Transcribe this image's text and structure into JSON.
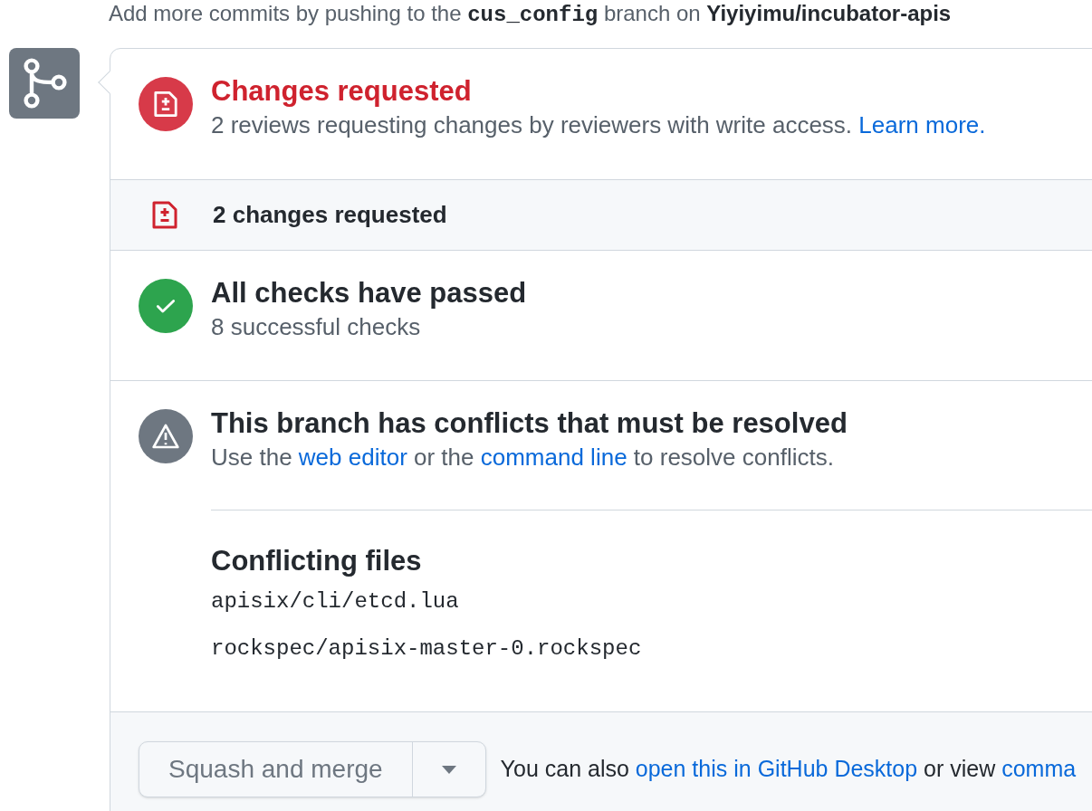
{
  "hint": [
    {
      "kind": "text",
      "text": "Add more commits by pushing to the "
    },
    {
      "kind": "code",
      "text": "cus_config"
    },
    {
      "kind": "text",
      "text": " branch on "
    },
    {
      "kind": "bold",
      "text": "Yiyiyimu/incubator-apis"
    }
  ],
  "sections": [
    {
      "kind": "review",
      "title": "Changes requested",
      "parts": [
        {
          "kind": "text",
          "text": "2 reviews requesting changes by reviewers with write access. "
        },
        {
          "kind": "link",
          "text": "Learn more."
        }
      ]
    },
    {
      "kind": "summary",
      "label": "2 changes requested"
    },
    {
      "kind": "checks",
      "title": "All checks have passed",
      "parts": [
        {
          "kind": "text",
          "text": "8 successful checks"
        }
      ]
    },
    {
      "kind": "conflicts",
      "title": "This branch has conflicts that must be resolved",
      "parts": [
        {
          "kind": "text",
          "text": "Use the "
        },
        {
          "kind": "link",
          "text": "web editor"
        },
        {
          "kind": "text",
          "text": " or the "
        },
        {
          "kind": "link",
          "text": "command line"
        },
        {
          "kind": "text",
          "text": " to resolve conflicts."
        }
      ],
      "files_title": "Conflicting files",
      "files": [
        "apisix/cli/etcd.lua",
        "rockspec/apisix-master-0.rockspec"
      ]
    }
  ],
  "merge": {
    "button": "Squash and merge",
    "parts": [
      {
        "kind": "text",
        "text": "You can also "
      },
      {
        "kind": "link",
        "text": "open this in GitHub Desktop"
      },
      {
        "kind": "text",
        "text": " or view "
      },
      {
        "kind": "link",
        "text": "comma"
      }
    ]
  }
}
